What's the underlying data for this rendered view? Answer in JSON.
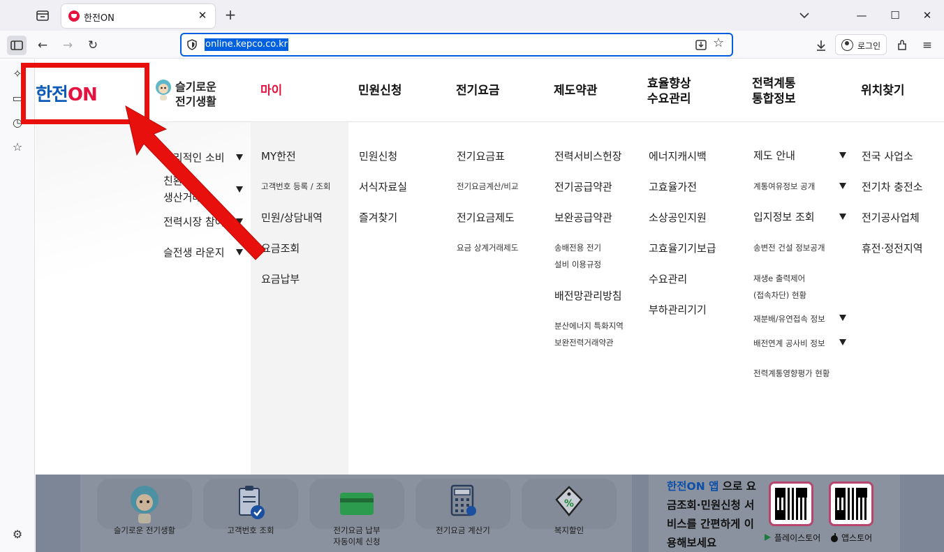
{
  "browser": {
    "tab": {
      "title": "한전ON"
    },
    "url": "online.kepco.co.kr",
    "login_label": "로그인",
    "icons": [
      "tab-list-icon",
      "close-icon",
      "plus-icon",
      "chevron-down-icon",
      "minimize-icon",
      "maximize-icon",
      "close-window-icon",
      "sidebar-icon",
      "back-icon",
      "forward-icon",
      "reload-icon",
      "shield-icon",
      "save-page-icon",
      "star-icon",
      "download-icon",
      "account-icon",
      "extensions-icon",
      "menu-icon",
      "ai-chatbot-icon",
      "synced-tabs-icon",
      "history-icon",
      "bookmarks-icon",
      "settings-icon"
    ]
  },
  "header": {
    "logo": {
      "main": "한전",
      "on": "ON"
    },
    "brand": {
      "line1": "슬기로운",
      "line2": "전기생활"
    },
    "gnb": [
      {
        "label": "마이"
      },
      {
        "label": "민원신청"
      },
      {
        "label": "전기요금"
      },
      {
        "label": "제도약관"
      },
      {
        "line1": "효율향상",
        "line2": "수요관리"
      },
      {
        "line1": "전력계통",
        "line2": "통합정보"
      },
      {
        "label": "위치찾기"
      }
    ]
  },
  "mega": {
    "left": [
      "합리적인 소비",
      "친환경",
      "생산거래",
      "전력시장 참여",
      "슬전생 라운지"
    ],
    "my": [
      "MY한전",
      "고객번호 등록 / 조회",
      "민원/상담내역",
      "요금조회",
      "요금납부"
    ],
    "minwon": [
      "민원신청",
      "서식자료실",
      "즐겨찾기"
    ],
    "fee": [
      "전기요금표",
      "전기요금계산/비교",
      "전기요금제도",
      "요금 상계거래제도"
    ],
    "policy": [
      "전력서비스헌장",
      "전기공급약관",
      "보완공급약관",
      "송배전용 전기",
      "설비 이용규정",
      "배전망관리방침",
      "분산에너지 특화지역",
      "보완전력거래약관"
    ],
    "efficiency": [
      "에너지캐시백",
      "고효율가전",
      "소상공인지원",
      "고효율기기보급",
      "수요관리",
      "부하관리기기"
    ],
    "grid": [
      "제도 안내",
      "계통여유정보 공개",
      "입지정보 조회",
      "송변전 건설 정보공개",
      "재생e 출력제어",
      "(접속차단) 현황",
      "재분배/유연접속 정보",
      "배전연계 공사비 정보",
      "전력계통영향평가 현황"
    ],
    "location": [
      "전국 사업소",
      "전기차 충전소",
      "전기공사업체",
      "휴전·정전지역"
    ]
  },
  "quick": [
    {
      "label": "슬기로운 전기생활"
    },
    {
      "label": "고객번호 조회"
    },
    {
      "line1": "전기요금 납부",
      "line2": "자동이체 신청"
    },
    {
      "label": "전기요금 계산기"
    },
    {
      "label": "복지할인"
    }
  ],
  "app_promo": {
    "highlight": "한전ON 앱",
    "text_1": " 으로 요",
    "text_2": "금조회·민원신청 서",
    "text_3": "비스를 간편하게 이",
    "text_4": "용해보세요",
    "play_store": "플레이스토어",
    "app_store": "앱스토어"
  },
  "annotation": {
    "color": "#e8100c"
  },
  "colors": {
    "brand_blue": "#0d5bb8",
    "brand_red": "#e5133f",
    "url_highlight": "#0061e0"
  }
}
